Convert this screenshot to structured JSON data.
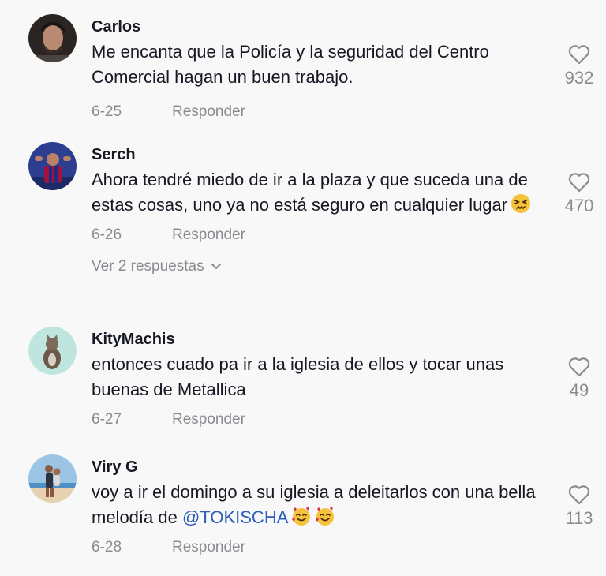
{
  "comments": [
    {
      "username": "Carlos",
      "text": "Me encanta que la Policía y la seguridad del Centro Comercial hagan un buen trabajo.",
      "date": "6-25",
      "reply_label": "Responder",
      "likes": "932",
      "avatar_icon": "avatar-photo-man"
    },
    {
      "username": "Serch",
      "text": "Ahora tendré miedo de ir a la plaza y que suceda una de estas cosas, uno ya no está seguro en cualquier lugar",
      "emoji": "persevering-face-emoji",
      "date": "6-26",
      "reply_label": "Responder",
      "view_replies": "Ver 2 respuestas",
      "likes": "470",
      "avatar_icon": "avatar-photo-player"
    },
    {
      "username": "KityMachis",
      "text": "entonces cuado pa ir a la iglesia de ellos y tocar unas buenas de Metallica",
      "date": "6-27",
      "reply_label": "Responder",
      "likes": "49",
      "avatar_icon": "avatar-photo-cat"
    },
    {
      "username": "Viry G",
      "text": "voy a ir el domingo a su iglesia a deleitarlos con una bella melodía de",
      "mention": "@TOKISCHA",
      "emoji": "smiling-face-with-hearts-emoji",
      "date": "6-28",
      "reply_label": "Responder",
      "likes": "113",
      "avatar_icon": "avatar-photo-couple"
    }
  ],
  "colors": {
    "background": "#f8f8f8",
    "text": "#161823",
    "muted": "#8a8b91",
    "mention": "#2b5db9"
  }
}
